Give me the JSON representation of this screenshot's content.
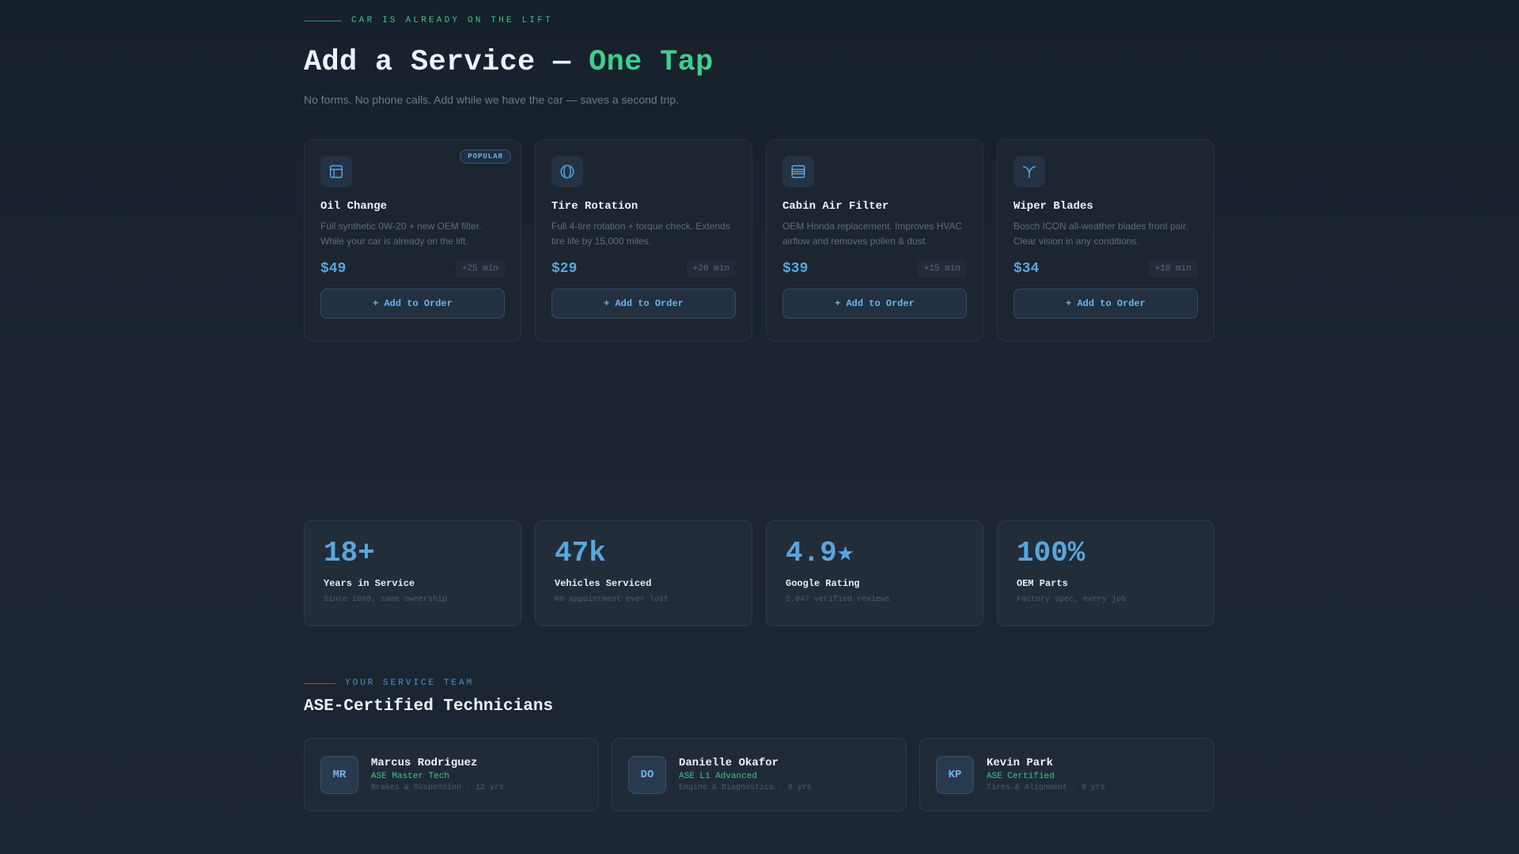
{
  "header": {
    "eyebrow": "CAR IS ALREADY ON THE LIFT",
    "title_main": "Add a Service — ",
    "title_accent": "One Tap",
    "subtitle": "No forms. No phone calls. Add while we have the car — saves a second trip."
  },
  "services": [
    {
      "icon": "oil-filter-icon",
      "name": "Oil Change",
      "badge": "POPULAR",
      "description": "Full synthetic 0W-20 + new OEM filter. While your car is already on the lift.",
      "price": "$49",
      "time": "+25 min",
      "button": "+ Add to Order"
    },
    {
      "icon": "tire-icon",
      "name": "Tire Rotation",
      "badge": "",
      "description": "Full 4-tire rotation + torque check. Extends tire life by 15,000 miles.",
      "price": "$29",
      "time": "+20 min",
      "button": "+ Add to Order"
    },
    {
      "icon": "air-filter-icon",
      "name": "Cabin Air Filter",
      "badge": "",
      "description": "OEM Honda replacement. Improves HVAC airflow and removes pollen & dust.",
      "price": "$39",
      "time": "+15 min",
      "button": "+ Add to Order"
    },
    {
      "icon": "wiper-icon",
      "name": "Wiper Blades",
      "badge": "",
      "description": "Bosch ICON all-weather blades front pair. Clear vision in any conditions.",
      "price": "$34",
      "time": "+10 min",
      "button": "+ Add to Order"
    }
  ],
  "stats": [
    {
      "value": "18+",
      "label": "Years in Service",
      "note": "Since 2008, same ownership"
    },
    {
      "value": "47k",
      "label": "Vehicles Serviced",
      "note": "No appointment ever lost"
    },
    {
      "value": "4.9★",
      "label": "Google Rating",
      "note": "2,847 verified reviews"
    },
    {
      "value": "100%",
      "label": "OEM Parts",
      "note": "Factory spec, every job"
    }
  ],
  "team": {
    "eyebrow": "YOUR SERVICE TEAM",
    "title": "ASE-Certified Technicians",
    "members": [
      {
        "initials": "MR",
        "name": "Marcus Rodriguez",
        "cert": "ASE Master Tech",
        "specialty": "Brakes & Suspension · 12 yrs"
      },
      {
        "initials": "DO",
        "name": "Danielle Okafor",
        "cert": "ASE L1 Advanced",
        "specialty": "Engine & Diagnostics · 9 yrs"
      },
      {
        "initials": "KP",
        "name": "Kevin Park",
        "cert": "ASE Certified",
        "specialty": "Tires & Alignment · 6 yrs"
      }
    ]
  },
  "colors": {
    "accent_green": "#3ecf8e",
    "accent_blue": "#5aa6de",
    "background": "#1b2430"
  }
}
